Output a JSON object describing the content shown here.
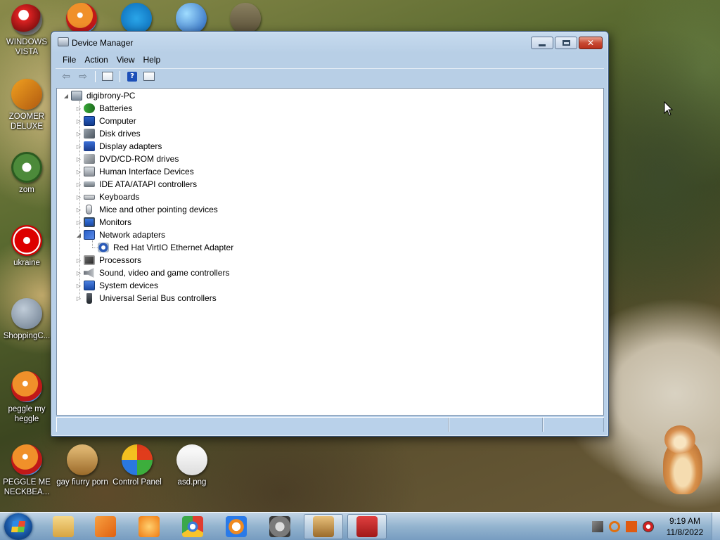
{
  "desktop": {
    "icons": [
      {
        "label": "WINDOWS VISTA"
      },
      {
        "label": "ZOOMER DELUXE"
      },
      {
        "label": "zom"
      },
      {
        "label": "ukraine"
      },
      {
        "label": "ShoppingC..."
      },
      {
        "label": "peggle my heggle"
      },
      {
        "label": "PEGGLE ME NECKBEA..."
      },
      {
        "label": "gay fiurry porn"
      },
      {
        "label": "Control Panel"
      },
      {
        "label": "asd.png"
      }
    ]
  },
  "window": {
    "title": "Device Manager",
    "menu": [
      "File",
      "Action",
      "View",
      "Help"
    ],
    "tree": {
      "root": "digibrony-PC",
      "categories": [
        {
          "label": "Batteries",
          "icon": "battery-icon"
        },
        {
          "label": "Computer",
          "icon": "computer-icon"
        },
        {
          "label": "Disk drives",
          "icon": "disk-drive-icon"
        },
        {
          "label": "Display adapters",
          "icon": "display-adapter-icon"
        },
        {
          "label": "DVD/CD-ROM drives",
          "icon": "dvd-drive-icon"
        },
        {
          "label": "Human Interface Devices",
          "icon": "hid-icon"
        },
        {
          "label": "IDE ATA/ATAPI controllers",
          "icon": "ide-controller-icon"
        },
        {
          "label": "Keyboards",
          "icon": "keyboard-icon"
        },
        {
          "label": "Mice and other pointing devices",
          "icon": "mouse-icon"
        },
        {
          "label": "Monitors",
          "icon": "monitor-icon"
        },
        {
          "label": "Network adapters",
          "icon": "network-adapter-icon",
          "expanded": true,
          "children": [
            {
              "label": "Red Hat VirtIO Ethernet Adapter",
              "icon": "ethernet-adapter-icon"
            }
          ]
        },
        {
          "label": "Processors",
          "icon": "processor-icon"
        },
        {
          "label": "Sound, video and game controllers",
          "icon": "sound-icon"
        },
        {
          "label": "System devices",
          "icon": "system-device-icon"
        },
        {
          "label": "Universal Serial Bus controllers",
          "icon": "usb-icon"
        }
      ]
    }
  },
  "taskbar": {
    "time": "9:19 AM",
    "date": "11/8/2022"
  },
  "colors": {
    "window_frame": "#b9d1ea",
    "taskbar": "#96b9d7",
    "close_button": "#c84a32"
  }
}
